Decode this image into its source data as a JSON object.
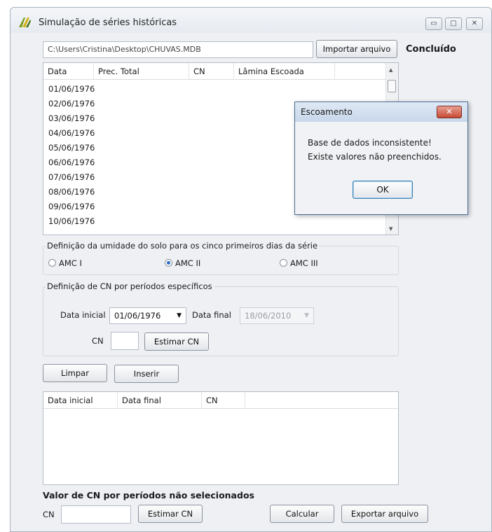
{
  "window": {
    "title": "Simulação de séries históricas",
    "controls": {
      "minimize": "▭",
      "maximize": "□",
      "close": "✕"
    }
  },
  "top": {
    "path_value": "C:\\Users\\Cristina\\Desktop\\CHUVAS.MDB",
    "import_button": "Importar arquivo",
    "status": "Concluído"
  },
  "series_table": {
    "headers": [
      "Data",
      "Prec. Total",
      "CN",
      "Lâmina Escoada"
    ],
    "rows": [
      "01/06/1976",
      "02/06/1976",
      "03/06/1976",
      "04/06/1976",
      "05/06/1976",
      "06/06/1976",
      "07/06/1976",
      "08/06/1976",
      "09/06/1976",
      "10/06/1976"
    ]
  },
  "amc_group": {
    "label": "Definição da umidade do solo para os cinco primeiros dias da série",
    "options": [
      "AMC I",
      "AMC II",
      "AMC III"
    ],
    "selected": "AMC II"
  },
  "cn_group": {
    "label": "Definição de CN por períodos específicos",
    "start_label": "Data inicial",
    "start_value": "01/06/1976",
    "end_label": "Data final",
    "end_value": "18/06/2010",
    "cn_label": "CN",
    "cn_value": "",
    "estimate_button": "Estimar CN"
  },
  "actions": {
    "clear_button": "Limpar",
    "insert_button": "Inserir"
  },
  "periods_table": {
    "headers": [
      "Data inicial",
      "Data final",
      "CN"
    ]
  },
  "bottom": {
    "title": "Valor de CN por períodos não selecionados",
    "cn_label": "CN",
    "cn_value": "",
    "estimate_button": "Estimar CN",
    "calculate_button": "Calcular",
    "export_button": "Exportar arquivo"
  },
  "dialog": {
    "title": "Escoamento",
    "close": "✕",
    "message_line1": "Base de dados inconsistente!",
    "message_line2": "Existe valores não preenchidos.",
    "ok_button": "OK"
  }
}
